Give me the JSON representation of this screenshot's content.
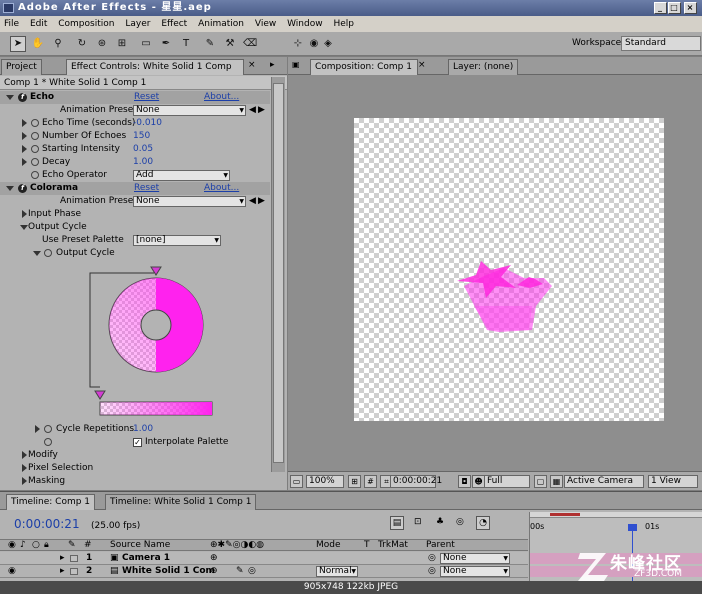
{
  "window": {
    "title": "Adobe After Effects - 星星.aep",
    "min": "_",
    "max": "□",
    "close": "×"
  },
  "menu": [
    "File",
    "Edit",
    "Composition",
    "Layer",
    "Effect",
    "Animation",
    "View",
    "Window",
    "Help"
  ],
  "toolbar": {
    "workspace_label": "Workspace:",
    "workspace_value": "Standard",
    "tool_icons": [
      "selection-tool",
      "hand-tool",
      "zoom-tool",
      "rotate-tool",
      "orbit-camera-tool",
      "pan-behind-tool",
      "rectangle-mask-tool",
      "pen-tool",
      "type-tool",
      "brush-tool",
      "clone-stamp-tool",
      "eraser-tool"
    ]
  },
  "left_panel": {
    "tabs": [
      "Project",
      "Effect Controls: White Solid 1 Comp 1"
    ],
    "comp_path": "Comp 1 * White Solid 1 Comp 1",
    "echo": {
      "name": "Echo",
      "reset": "Reset",
      "about": "About...",
      "presets_label": "Animation Presets:",
      "presets_value": "None",
      "params": [
        {
          "label": "Echo Time (seconds)",
          "value": "-0.010"
        },
        {
          "label": "Number Of Echoes",
          "value": "150"
        },
        {
          "label": "Starting Intensity",
          "value": "0.05"
        },
        {
          "label": "Decay",
          "value": "1.00"
        }
      ],
      "operator_label": "Echo Operator",
      "operator_value": "Add"
    },
    "colorama": {
      "name": "Colorama",
      "reset": "Reset",
      "about": "About...",
      "presets_label": "Animation Presets:",
      "presets_value": "None",
      "input_phase": "Input Phase",
      "output_cycle": "Output Cycle",
      "use_preset_label": "Use Preset Palette",
      "use_preset_value": "[none]",
      "output_cycle_sub": "Output Cycle",
      "cycle_rep_label": "Cycle Repetitions",
      "cycle_rep_value": "1.00",
      "interpolate_label": "Interpolate Palette",
      "modify": "Modify",
      "pixel_selection": "Pixel Selection",
      "masking": "Masking"
    }
  },
  "right_panel": {
    "tabs": [
      "Composition: Comp 1",
      "Layer: (none)"
    ],
    "viewer_bar": {
      "zoom": "100%",
      "timecode": "0:00:00:21",
      "resolution": "Full",
      "camera": "Active Camera",
      "views": "1 View"
    }
  },
  "timeline": {
    "tabs": [
      "Timeline: Comp 1",
      "Timeline: White Solid 1 Comp 1"
    ],
    "timecode": "0:00:00:21",
    "fps": "(25.00 fps)",
    "columns": {
      "source": "Source Name",
      "mode": "Mode",
      "t": "T",
      "trkmat": "TrkMat",
      "parent": "Parent"
    },
    "layers": [
      {
        "num": "1",
        "name": "Camera 1",
        "mode": "",
        "parent": "None"
      },
      {
        "num": "2",
        "name": "White Solid 1 Com",
        "mode": "Normal",
        "parent": "None"
      }
    ],
    "ruler": {
      "start": "00s",
      "mark": "01s"
    }
  },
  "caption": "905x748  122kb  JPEG",
  "watermark": {
    "text": "朱峰社区",
    "sub": "ZF3D.COM"
  },
  "colors": {
    "magenta": "#ff33ee",
    "link_blue": "#1c3fa8",
    "titlebar": "#4a5c88"
  }
}
